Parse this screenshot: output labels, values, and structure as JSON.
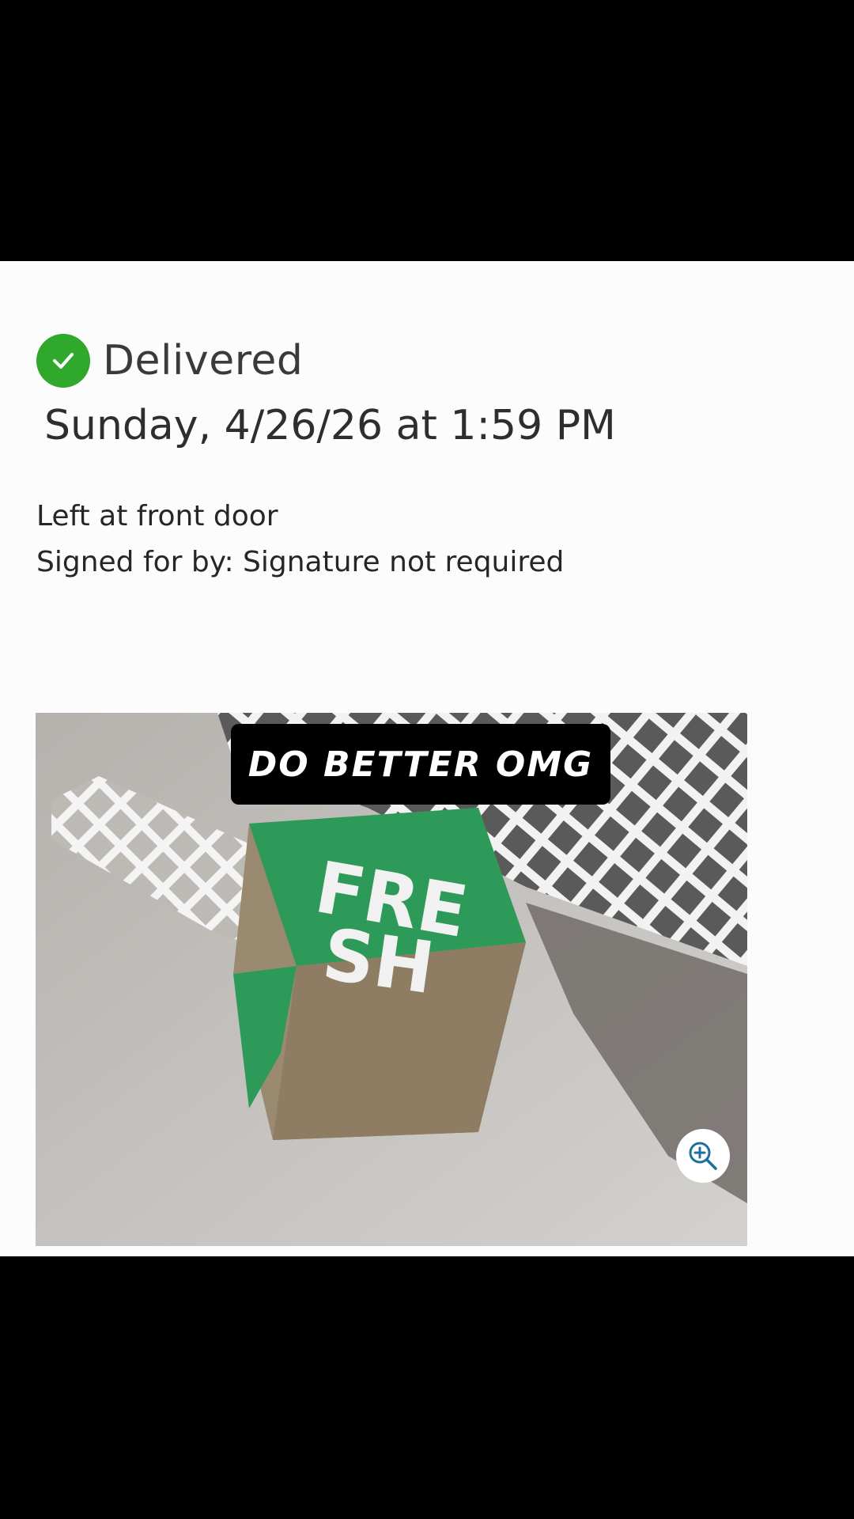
{
  "delivery": {
    "status": "Delivered",
    "datetime": "Sunday, 4/26/26 at 1:59 PM",
    "location": "Left at front door",
    "signature": "Signed for by: Signature not required"
  },
  "photo": {
    "caption": "DO BETTER OMG",
    "box_text": "FRESH"
  },
  "icons": {
    "status": "check-circle-icon",
    "zoom": "zoom-in-icon"
  },
  "colors": {
    "status_green": "#2fa82c",
    "zoom_blue": "#1e6f9b",
    "box_green": "#2e9a5a"
  }
}
